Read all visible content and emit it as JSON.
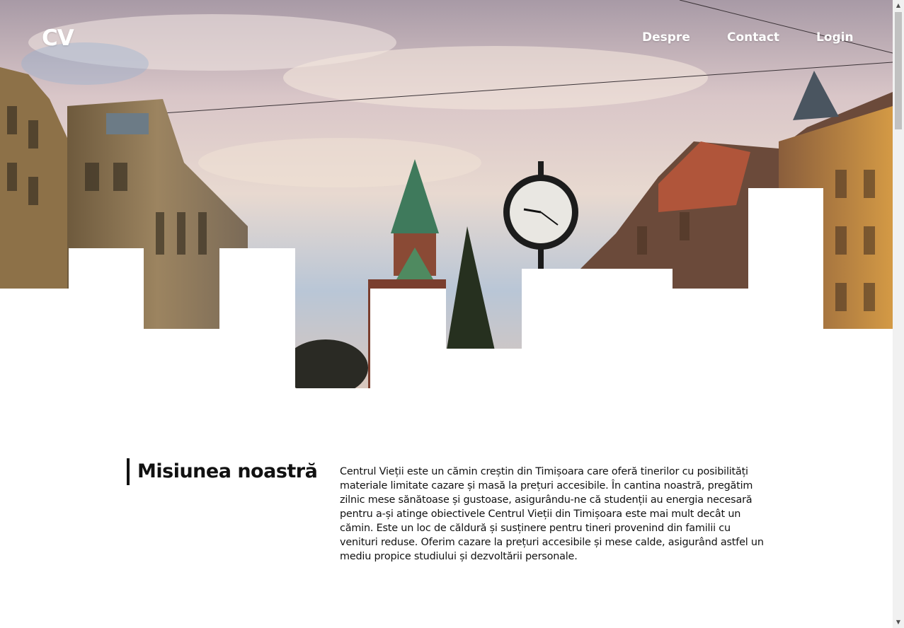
{
  "nav": {
    "logo": "CV",
    "links": [
      "Despre",
      "Contact",
      "Login"
    ]
  },
  "hero": {
    "image_alt": "Timișoara city center with clock and cathedral tower"
  },
  "mission": {
    "heading": "Misiunea noastră",
    "text": "Centrul Vieții este un cămin creștin din Timișoara care oferă tinerilor cu posibilități materiale limitate cazare și masă la prețuri accesibile. În cantina noastră, pregătim zilnic mese sănătoase și gustoase, asigurându-ne că studenții au energia necesară pentru a-și atinge obiectivele Centrul Vieții din Timișoara este mai mult decât un cămin. Este un loc de căldură și susținere pentru tineri provenind din familii cu venituri reduse. Oferim cazare la prețuri accesibile și mese calde, asigurând astfel un mediu propice studiului și dezvoltării personale."
  },
  "colors": {
    "text": "#111111",
    "background": "#ffffff",
    "nav_text": "#ffffff"
  },
  "icons": [
    "scroll-up-arrow-icon",
    "scroll-down-arrow-icon"
  ]
}
